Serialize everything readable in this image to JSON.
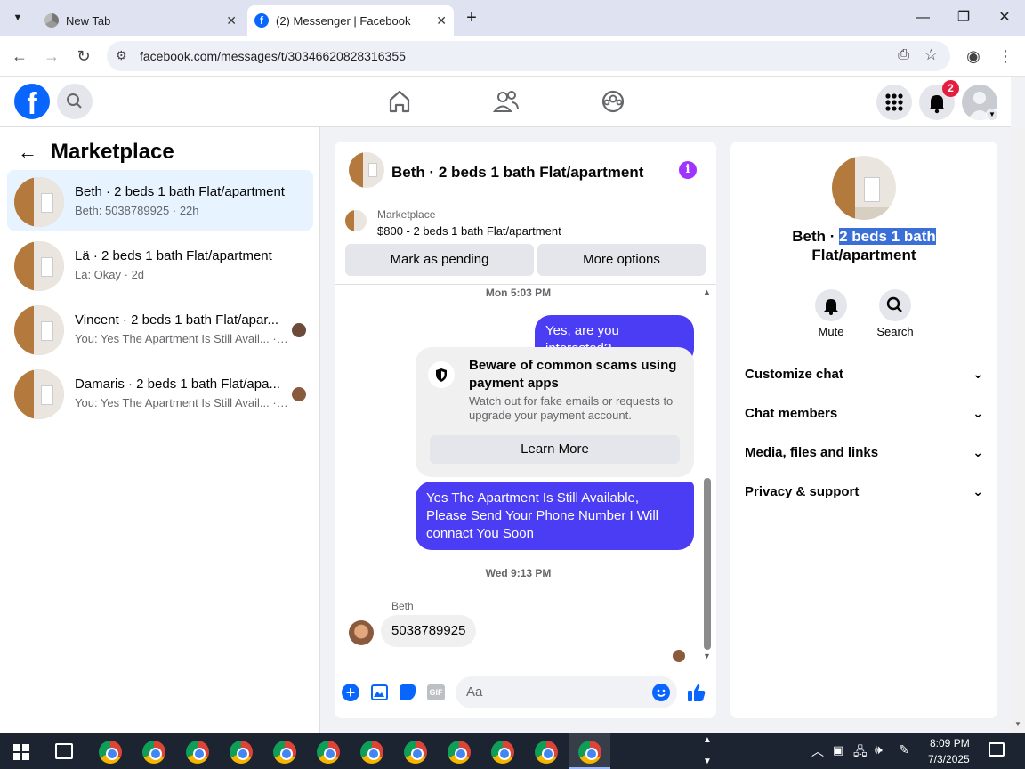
{
  "browser": {
    "tabs": [
      {
        "title": "New Tab",
        "active": false
      },
      {
        "title": "(2) Messenger | Facebook",
        "active": true
      }
    ],
    "url": "facebook.com/messages/t/30346620828316355"
  },
  "header": {
    "notifications_count": "2"
  },
  "left": {
    "title": "Marketplace",
    "conversations": [
      {
        "title": "Beth · 2 beds 1 bath Flat/apartment",
        "sub": "Beth: 5038789925 · 22h"
      },
      {
        "title": "Lä · 2 beds 1 bath Flat/apartment",
        "sub": "Lä: Okay · 2d"
      },
      {
        "title": "Vincent · 2 beds 1 bath Flat/apar...",
        "sub": "You: Yes The Apartment Is Still Avail... · 3d"
      },
      {
        "title": "Damaris · 2 beds 1 bath Flat/apa...",
        "sub": "You: Yes The Apartment Is Still Avail... · 3d"
      }
    ]
  },
  "chat": {
    "title": "Beth · 2 beds 1 bath Flat/apartment",
    "listing_label": "Marketplace",
    "listing_desc": "$800 - 2 beds 1 bath Flat/apartment",
    "btn_pending": "Mark as pending",
    "btn_more": "More options",
    "sep1": "Mon 5:03 PM",
    "msg1": "Yes, are you interested?",
    "warn_title": "Beware of common scams using payment apps",
    "warn_body": "Watch out for fake emails or requests to upgrade your payment account.",
    "learn_more": "Learn More",
    "msg2": "Yes The Apartment Is Still Available, Please Send Your Phone Number I Will connact You Soon",
    "sep2": "Wed 9:13 PM",
    "sender": "Beth",
    "msg3": "5038789925",
    "composer_placeholder": "Aa"
  },
  "right": {
    "name_prefix": "Beth · ",
    "name_selected": "2 beds 1 bath",
    "name_suffix": "Flat/apartment",
    "mute": "Mute",
    "search": "Search",
    "sections": [
      "Customize chat",
      "Chat members",
      "Media, files and links",
      "Privacy & support"
    ]
  },
  "taskbar": {
    "time": "8:09 PM",
    "date": "7/3/2025"
  },
  "colors": {
    "fb_blue": "#0866ff",
    "messenger_purple": "#a033ff",
    "outgoing_bubble": "#4b3df4",
    "selection": "#3a6fd8"
  }
}
